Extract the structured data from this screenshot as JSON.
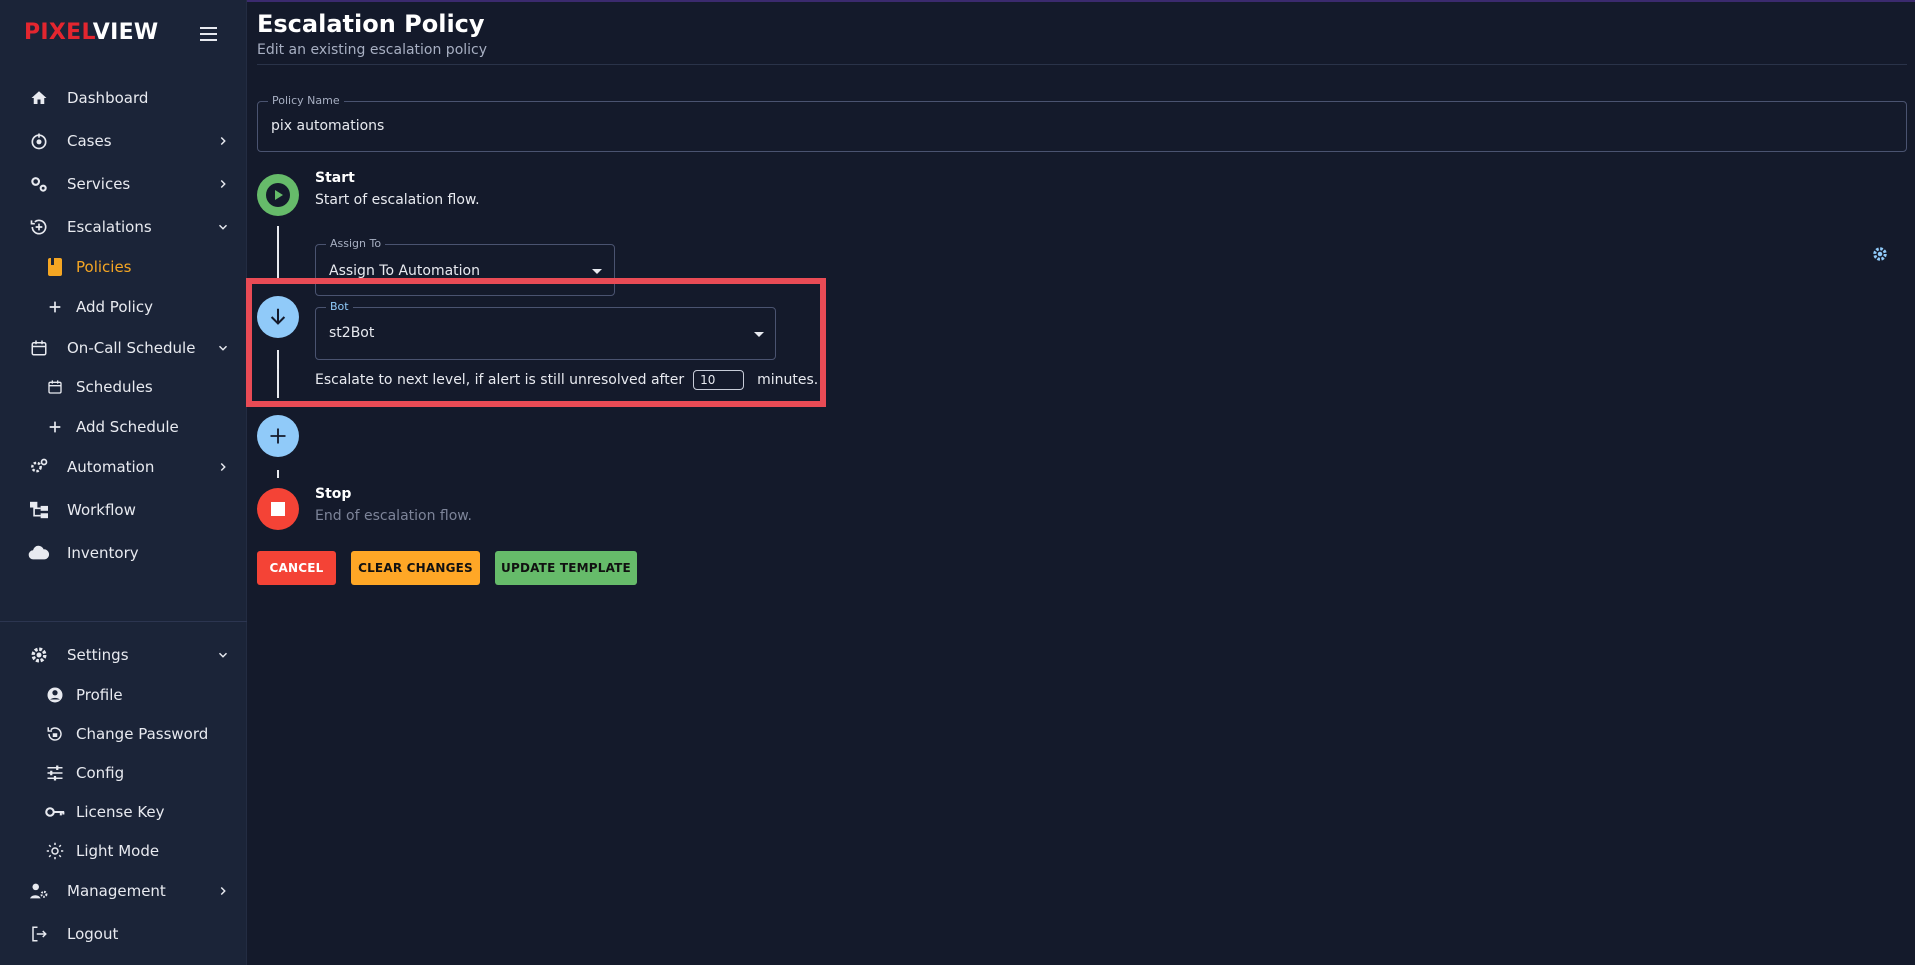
{
  "brand": {
    "part1": "PIXEL",
    "part2": "VIEW"
  },
  "sidebar": {
    "items": [
      {
        "key": "dashboard",
        "label": "Dashboard",
        "icon": "home-icon"
      },
      {
        "key": "cases",
        "label": "Cases",
        "icon": "cases-icon"
      },
      {
        "key": "services",
        "label": "Services",
        "icon": "services-icon"
      },
      {
        "key": "escalations",
        "label": "Escalations",
        "icon": "escalations-icon"
      },
      {
        "key": "policies",
        "label": "Policies",
        "icon": "book-icon",
        "active": true
      },
      {
        "key": "add-policy",
        "label": "Add Policy",
        "icon": "plus-icon"
      },
      {
        "key": "on-call",
        "label": "On-Call Schedule",
        "icon": "calendar-icon"
      },
      {
        "key": "schedules",
        "label": "Schedules",
        "icon": "calendar-icon"
      },
      {
        "key": "add-schedule",
        "label": "Add Schedule",
        "icon": "plus-icon"
      },
      {
        "key": "automation",
        "label": "Automation",
        "icon": "gears-icon"
      },
      {
        "key": "workflow",
        "label": "Workflow",
        "icon": "workflow-icon"
      },
      {
        "key": "inventory",
        "label": "Inventory",
        "icon": "cloud-icon"
      },
      {
        "key": "settings",
        "label": "Settings",
        "icon": "gear-icon"
      },
      {
        "key": "profile",
        "label": "Profile",
        "icon": "account-icon"
      },
      {
        "key": "change-password",
        "label": "Change Password",
        "icon": "lock-reset-icon"
      },
      {
        "key": "config",
        "label": "Config",
        "icon": "sliders-icon"
      },
      {
        "key": "license-key",
        "label": "License Key",
        "icon": "key-icon"
      },
      {
        "key": "light-mode",
        "label": "Light Mode",
        "icon": "sun-icon"
      },
      {
        "key": "management",
        "label": "Management",
        "icon": "user-gear-icon"
      },
      {
        "key": "logout",
        "label": "Logout",
        "icon": "logout-icon"
      }
    ]
  },
  "header": {
    "title": "Escalation Policy",
    "subtitle": "Edit an existing escalation policy"
  },
  "policy_name": {
    "label": "Policy Name",
    "value": "pix automations"
  },
  "flow": {
    "start": {
      "title": "Start",
      "desc": "Start of escalation flow."
    },
    "assign_to": {
      "label": "Assign To",
      "value": "Assign To Automation"
    },
    "bot": {
      "label": "Bot",
      "value": "st2Bot"
    },
    "escalate": {
      "prefix": "Escalate to next level, if alert is still unresolved after",
      "minutes": "10",
      "suffix": "minutes."
    },
    "stop": {
      "title": "Stop",
      "desc": "End of escalation flow."
    }
  },
  "buttons": {
    "cancel": "CANCEL",
    "clear": "CLEAR CHANGES",
    "update": "UPDATE TEMPLATE"
  },
  "colors": {
    "accent_active": "#f5a623",
    "start_green": "#66bb6a",
    "step_blue": "#90caf9",
    "stop_red": "#f44336",
    "highlight": "#e94b55"
  }
}
